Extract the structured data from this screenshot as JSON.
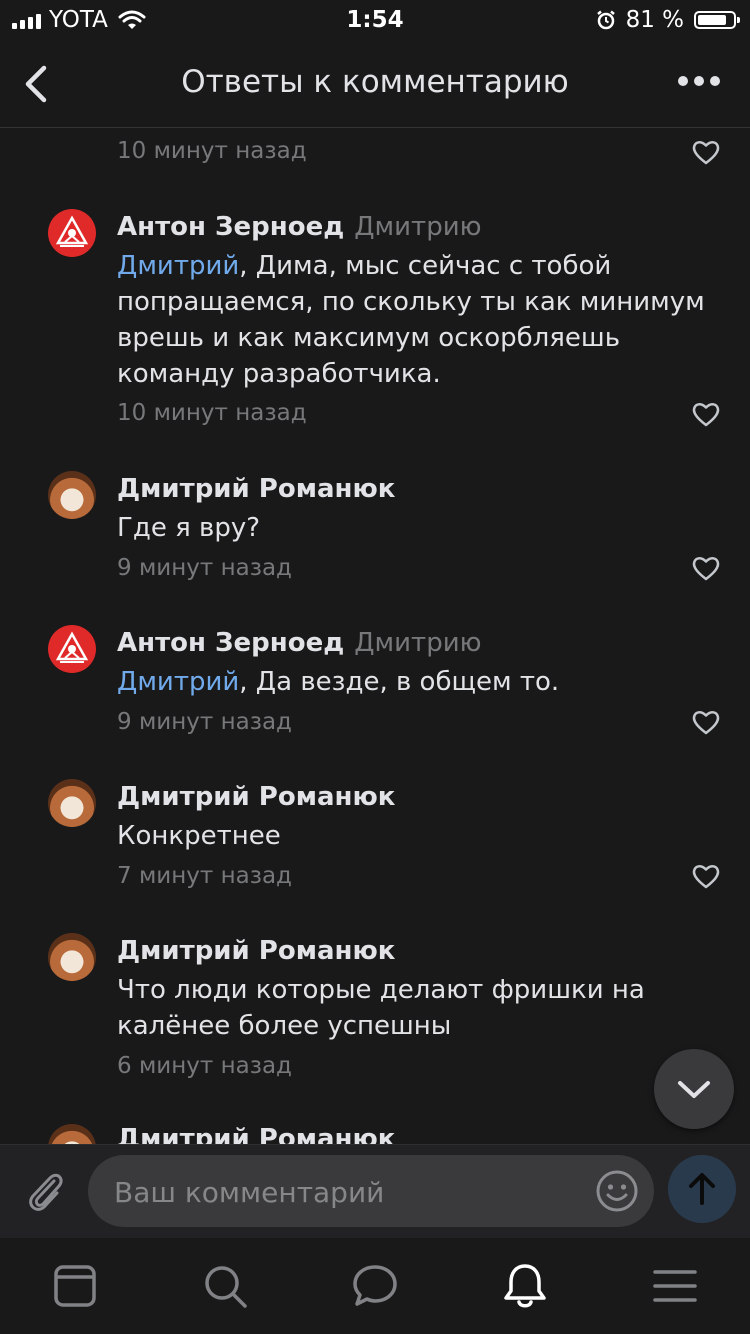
{
  "status_bar": {
    "carrier": "YOTA",
    "time": "1:54",
    "battery_percent": "81 %",
    "battery_level": 0.81
  },
  "header": {
    "title": "Ответы к комментарию"
  },
  "comments": [
    {
      "author": "",
      "reply_to": "",
      "mention": "",
      "text": "",
      "time": "10 минут назад",
      "avatar": "none"
    },
    {
      "author": "Антон Зерноед",
      "reply_to": "Дмитрию",
      "mention": "Дмитрий",
      "text": ", Дима, мыс сейчас с тобой попращаемся, по скольку ты как минимум врешь и как максимум оскорбляешь команду разработчика.",
      "time": "10 минут назад",
      "avatar": "red-emblem"
    },
    {
      "author": "Дмитрий Романюк",
      "reply_to": "",
      "mention": "",
      "text": "Где я вру?",
      "time": "9 минут назад",
      "avatar": "cat"
    },
    {
      "author": "Антон Зерноед",
      "reply_to": "Дмитрию",
      "mention": "Дмитрий",
      "text": ", Да везде, в общем то.",
      "time": "9 минут назад",
      "avatar": "red-emblem"
    },
    {
      "author": "Дмитрий Романюк",
      "reply_to": "",
      "mention": "",
      "text": "Конкретнее",
      "time": "7 минут назад",
      "avatar": "cat"
    },
    {
      "author": "Дмитрий Романюк",
      "reply_to": "",
      "mention": "",
      "text": "Что люди которые делают фришки на калёнее более успешны",
      "time": "6 минут назад",
      "avatar": "cat"
    },
    {
      "author": "Дмитрий Романюк",
      "reply_to": "",
      "mention": "",
      "text": "",
      "time": "",
      "avatar": "cat"
    }
  ],
  "composer": {
    "placeholder": "Ваш комментарий"
  },
  "tabbar": {
    "items": [
      "news-icon",
      "search-icon",
      "messages-icon",
      "notifications-icon",
      "menu-icon"
    ],
    "active": "notifications-icon"
  },
  "colors": {
    "background": "#19191a",
    "text": "#e1e3e6",
    "secondary": "#76787a",
    "mention": "#71aaeb"
  }
}
